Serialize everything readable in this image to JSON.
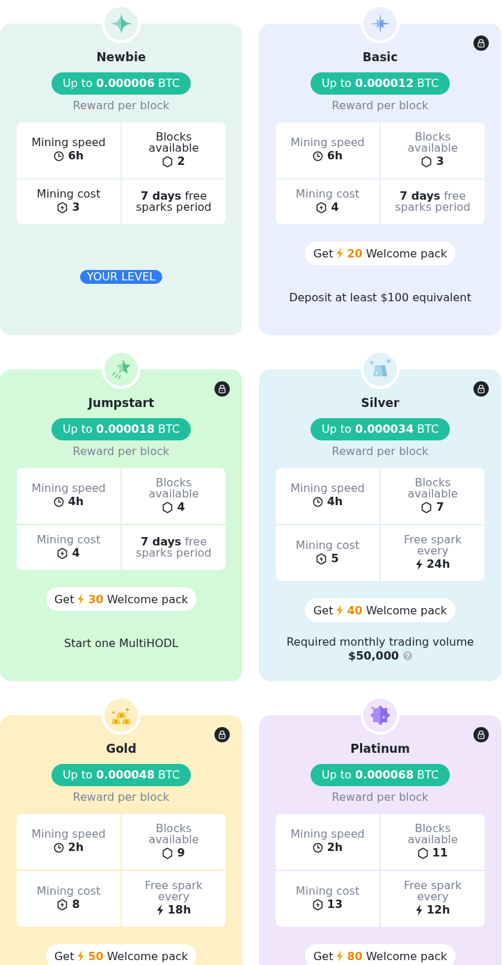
{
  "tiers": [
    {
      "name": "Newbie",
      "color": "#e6f4f1",
      "locked": false,
      "reward": "Up to **0.000006** BTC",
      "reward_caption": "Reward per block",
      "stats": [
        {
          "kind": "speed",
          "label": "Mining speed",
          "value": "6h"
        },
        {
          "kind": "blocks",
          "label": "Blocks available",
          "value": "2"
        },
        {
          "kind": "cost",
          "label": "Mining cost",
          "value": "3"
        },
        {
          "kind": "period",
          "text": "**7 days** free sparks period"
        }
      ],
      "badge": "YOUR LEVEL"
    },
    {
      "name": "Basic",
      "color": "#e9effd",
      "locked": true,
      "reward": "Up to **0.000012** BTC",
      "reward_caption": "Reward per block",
      "stats": [
        {
          "kind": "speed",
          "label": "Mining speed",
          "value": "6h"
        },
        {
          "kind": "blocks",
          "label": "Blocks available",
          "value": "3"
        },
        {
          "kind": "cost",
          "label": "Mining cost",
          "value": "4"
        },
        {
          "kind": "period",
          "text": "**7 days** free sparks period"
        }
      ],
      "welcome": {
        "prefix": "Get",
        "amount": "20",
        "suffix": "Welcome pack"
      },
      "requirement": {
        "text": "Deposit at least $100 equivalent"
      }
    },
    {
      "name": "Jumpstart",
      "color": "#d3f9d8",
      "locked": true,
      "reward": "Up to **0.000018** BTC",
      "reward_caption": "Reward per block",
      "stats": [
        {
          "kind": "speed",
          "label": "Mining speed",
          "value": "4h"
        },
        {
          "kind": "blocks",
          "label": "Blocks available",
          "value": "4"
        },
        {
          "kind": "cost",
          "label": "Mining cost",
          "value": "4"
        },
        {
          "kind": "period",
          "text": "**7 days** free sparks period"
        }
      ],
      "welcome": {
        "prefix": "Get",
        "amount": "30",
        "suffix": "Welcome pack"
      },
      "requirement": {
        "text": "Start one MultiHODL"
      }
    },
    {
      "name": "Silver",
      "color": "#e1f2f9",
      "locked": true,
      "reward": "Up to **0.000034** BTC",
      "reward_caption": "Reward per block",
      "stats": [
        {
          "kind": "speed",
          "label": "Mining speed",
          "value": "4h"
        },
        {
          "kind": "blocks",
          "label": "Blocks available",
          "value": "7"
        },
        {
          "kind": "cost",
          "label": "Mining cost",
          "value": "5"
        },
        {
          "kind": "spark",
          "label": "Free spark every",
          "value": "24h"
        }
      ],
      "welcome": {
        "prefix": "Get",
        "amount": "40",
        "suffix": "Welcome pack"
      },
      "requirement": {
        "text": "Required monthly trading volume",
        "amount": "$50,000"
      }
    },
    {
      "name": "Gold",
      "color": "#fdf0c4",
      "locked": true,
      "reward": "Up to **0.000048** BTC",
      "reward_caption": "Reward per block",
      "stats": [
        {
          "kind": "speed",
          "label": "Mining speed",
          "value": "2h"
        },
        {
          "kind": "blocks",
          "label": "Blocks available",
          "value": "9"
        },
        {
          "kind": "cost",
          "label": "Mining cost",
          "value": "8"
        },
        {
          "kind": "spark",
          "label": "Free spark every",
          "value": "18h"
        }
      ],
      "welcome": {
        "prefix": "Get",
        "amount": "50",
        "suffix": "Welcome pack"
      }
    },
    {
      "name": "Platinum",
      "color": "#f0e5fb",
      "locked": true,
      "reward": "Up to **0.000068** BTC",
      "reward_caption": "Reward per block",
      "stats": [
        {
          "kind": "speed",
          "label": "Mining speed",
          "value": "2h"
        },
        {
          "kind": "blocks",
          "label": "Blocks available",
          "value": "11"
        },
        {
          "kind": "cost",
          "label": "Mining cost",
          "value": "13"
        },
        {
          "kind": "spark",
          "label": "Free spark every",
          "value": "12h"
        }
      ],
      "welcome": {
        "prefix": "Get",
        "amount": "80",
        "suffix": "Welcome pack"
      }
    }
  ]
}
